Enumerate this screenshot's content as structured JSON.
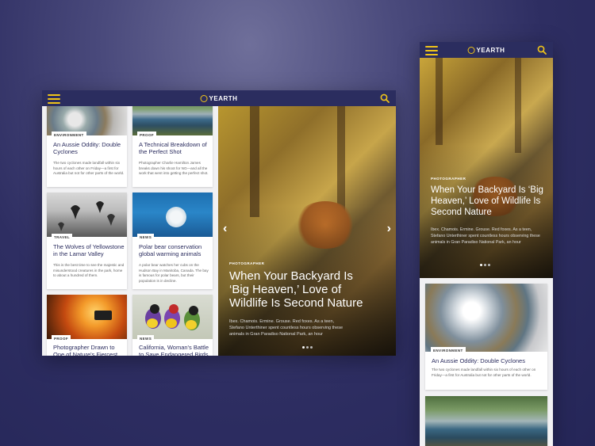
{
  "brand": {
    "name": "YEARTH",
    "accent": "#f0c419",
    "navy": "#2b2d5f"
  },
  "tablet": {
    "cards": [
      {
        "tag": "ENVIRONMENT",
        "title": "An Aussie Oddity: Double Cyclones",
        "desc": "The two cyclones made landfall within six hours of each other on Friday—a first for Australia but not for other parts of the world."
      },
      {
        "tag": "PROOF",
        "title": "A Technical Breakdown of the Perfect Shot",
        "desc": "Photographer Charlie Hamilton James breaks down his shoot for NG—and all the work that went into getting the perfect shot."
      },
      {
        "tag": "TRAVEL",
        "title": "The Wolves of Yellowstone in the Lamar Valley",
        "desc": "This is the best time to see the majestic and misunderstood creatures in the park, home to about a hundred of them."
      },
      {
        "tag": "NEWS",
        "title": "Polar bear conservation global warming animals",
        "desc": "A polar bear watches her cubs on the Hudson Bay in Manitoba, Canada. The bay is famous for polar bears, but their population is in decline."
      },
      {
        "tag": "PROOF",
        "title": "Photographer Drawn to One of Nature's Fiercest Forces",
        "desc": ""
      },
      {
        "tag": "NEWS",
        "title": "California, Woman's Battle to Save Endangered Birds",
        "desc": ""
      }
    ],
    "hero": {
      "kicker": "PHOTOGRAPHER",
      "title": "When Your Backyard Is ‘Big Heaven,’ Love of Wildlife Is Second Nature",
      "text": "Ibex. Chamois. Ermine. Grouse. Red foxes. As a teen, Stefano Unterthiner spent countless hours observing these animals in Gran Paradiso National Park, an hour"
    }
  },
  "phone": {
    "hero": {
      "kicker": "PHOTOGRAPHER",
      "title": "When Your Backyard Is ‘Big Heaven,’ Love of Wildlife Is Second Nature",
      "text": "Ibex. Chamois. Ermine. Grouse. Red foxes. As a teen, Stefano Unterthiner spent countless hours observing these animals in Gran Paradiso National Park, an hour"
    },
    "card": {
      "tag": "ENVIRONMENT",
      "title": "An Aussie Oddity: Double Cyclones",
      "desc": "The two cyclones made landfall within six hours of each other on Friday—a first for Australia but not for other parts of the world."
    }
  }
}
